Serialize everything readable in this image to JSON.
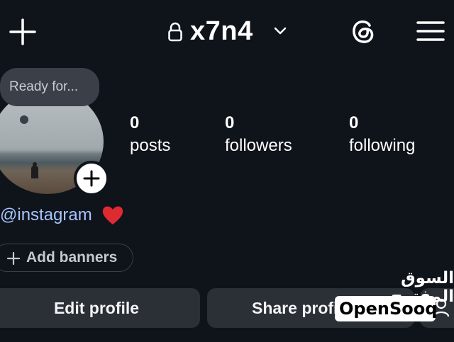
{
  "header": {
    "username": "x7n4"
  },
  "icons": {
    "create": "plus-icon",
    "lock": "lock-icon",
    "switch_account": "chevron-down-icon",
    "threads": "threads-icon",
    "menu": "hamburger-menu-icon",
    "add_story": "plus-icon",
    "heart": "heart-icon",
    "add_banner": "plus-icon",
    "discover_people": "person-add-icon"
  },
  "note": {
    "text": "Ready for..."
  },
  "stats": [
    {
      "value": "0",
      "label": "posts"
    },
    {
      "value": "0",
      "label": "followers"
    },
    {
      "value": "0",
      "label": "following"
    }
  ],
  "bio": {
    "handle": "@instagram"
  },
  "banners": {
    "label": "Add banners"
  },
  "actions": {
    "edit": "Edit profile",
    "share": "Share profile"
  },
  "watermark": {
    "arabic": "السوق المفتوح",
    "latin": "OpenSooq"
  },
  "colors": {
    "background": "#0f131a",
    "button": "#2b2f36",
    "handle": "#a6c4ff",
    "heart": "#e02a32"
  }
}
